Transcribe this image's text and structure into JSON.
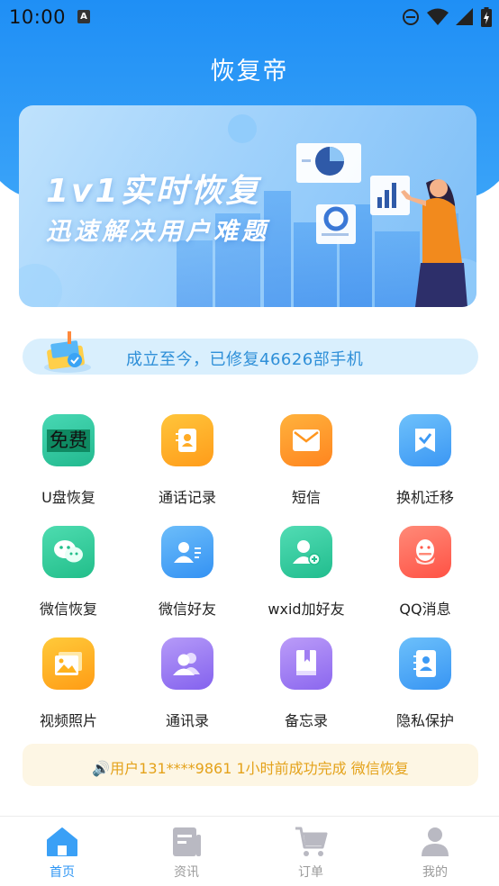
{
  "status_bar": {
    "time": "10:00",
    "a_badge": "A",
    "icons": [
      "a-badge-icon",
      "dnd-icon",
      "wifi-icon",
      "signal-icon",
      "battery-icon"
    ]
  },
  "app": {
    "title": "恢复帝"
  },
  "banner": {
    "line1": "1v1实时恢复",
    "line2": "迅速解决用户难题"
  },
  "notice": {
    "text": "成立至今，已修复46626部手机"
  },
  "features": [
    {
      "label": "U盘恢复",
      "icon": "free-badge-icon",
      "badge": "免费",
      "color": "#2ec9a4"
    },
    {
      "label": "通话记录",
      "icon": "contact-book-icon",
      "color": "#ffaa22"
    },
    {
      "label": "短信",
      "icon": "envelope-icon",
      "color": "#ff9a2e"
    },
    {
      "label": "换机迁移",
      "icon": "check-bookmark-icon",
      "color": "#4ea8f8"
    },
    {
      "label": "微信恢复",
      "icon": "wechat-icon",
      "color": "#2fcf9a"
    },
    {
      "label": "微信好友",
      "icon": "friend-card-icon",
      "color": "#48a4f7"
    },
    {
      "label": "wxid加好友",
      "icon": "add-user-icon",
      "color": "#30cfa0"
    },
    {
      "label": "QQ消息",
      "icon": "qq-penguin-icon",
      "color": "#ff6d5e"
    },
    {
      "label": "视频照片",
      "icon": "photo-icon",
      "color": "#ffb21c"
    },
    {
      "label": "通讯录",
      "icon": "group-users-icon",
      "color": "#9c7ff3"
    },
    {
      "label": "备忘录",
      "icon": "memo-book-icon",
      "color": "#a47ef2"
    },
    {
      "label": "隐私保护",
      "icon": "privacy-book-icon",
      "color": "#4aa6f7"
    }
  ],
  "ticker": {
    "text": "🔊用户131****9861 1小时前成功完成 微信恢复",
    "color": "#e4a21a"
  },
  "tabs": [
    {
      "label": "首页",
      "icon": "home-icon",
      "active": true
    },
    {
      "label": "资讯",
      "icon": "news-icon",
      "active": false
    },
    {
      "label": "订单",
      "icon": "cart-icon",
      "active": false
    },
    {
      "label": "我的",
      "icon": "profile-icon",
      "active": false
    }
  ],
  "colors": {
    "primary": "#1f8ff5",
    "active_tab": "#2d95f4",
    "inactive_tab": "#9b9b9b",
    "notice_text": "#2e8fd8"
  }
}
